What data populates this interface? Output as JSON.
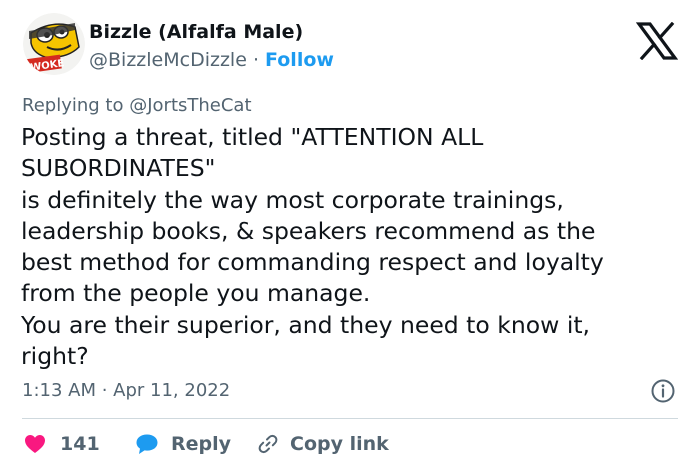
{
  "author": {
    "name": "Bizzle (Alfalfa Male)",
    "handle": "@BizzleMcDizzle",
    "separator": "·",
    "follow_label": "Follow",
    "avatar_text": "WOKE"
  },
  "reply_context": {
    "prefix": "Replying to",
    "handle": "@JortsTheCat"
  },
  "tweet": {
    "lines": [
      "Posting a threat, titled \"ATTENTION ALL",
      "SUBORDINATES\"",
      "is definitely the way most corporate trainings,",
      "leadership books, & speakers recommend as the",
      "best method for commanding respect and loyalty",
      "from the people you manage.",
      "You are their superior, and they need to know it,",
      "right?"
    ],
    "timestamp": "1:13 AM · Apr 11, 2022"
  },
  "actions": {
    "like_count": "141",
    "reply_label": "Reply",
    "copy_link_label": "Copy link"
  },
  "colors": {
    "link_blue": "#1d9bf0",
    "heart_pink": "#f91880",
    "muted_gray": "#536471",
    "text": "#0f1419",
    "divider": "#cfd9de"
  },
  "icons": {
    "brand": "x-logo-icon",
    "info": "info-icon",
    "like": "heart-icon",
    "reply": "reply-bubble-icon",
    "copy": "link-icon"
  }
}
